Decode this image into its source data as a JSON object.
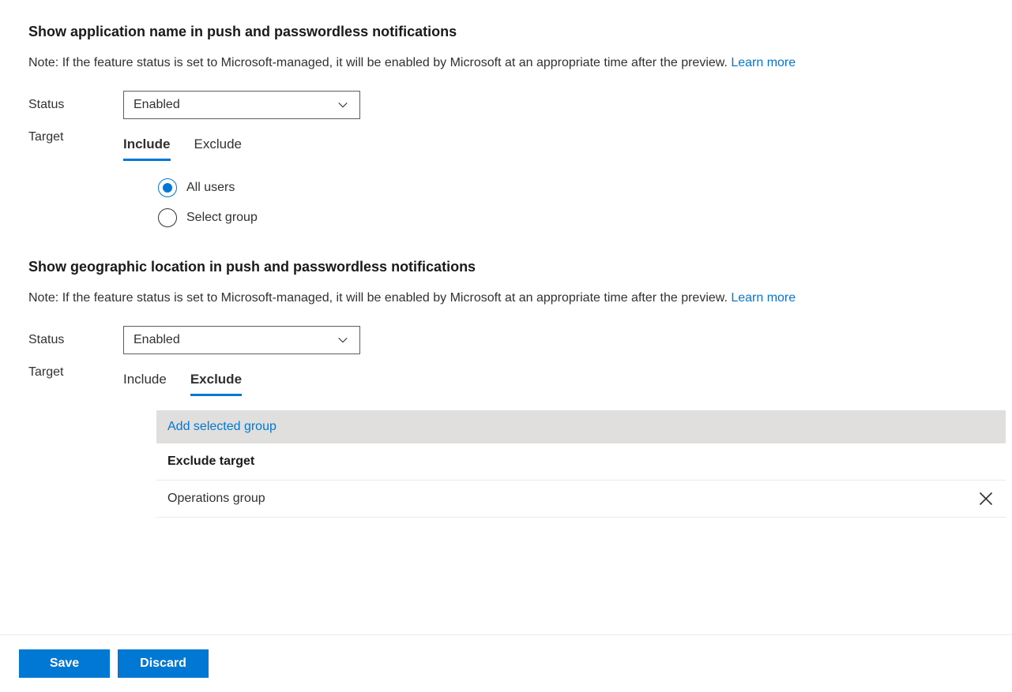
{
  "section1": {
    "title": "Show application name in push and passwordless notifications",
    "note": "Note: If the feature status is set to Microsoft-managed, it will be enabled by Microsoft at an appropriate time after the preview. ",
    "learn_more": "Learn more",
    "status_label": "Status",
    "status_value": "Enabled",
    "target_label": "Target",
    "tab_include": "Include",
    "tab_exclude": "Exclude",
    "radio_all": "All users",
    "radio_group": "Select group"
  },
  "section2": {
    "title": "Show geographic location in push and passwordless notifications",
    "note": "Note: If the feature status is set to Microsoft-managed, it will be enabled by Microsoft at an appropriate time after the preview. ",
    "learn_more": "Learn more",
    "status_label": "Status",
    "status_value": "Enabled",
    "target_label": "Target",
    "tab_include": "Include",
    "tab_exclude": "Exclude",
    "add_group": "Add selected group",
    "table_header": "Exclude target",
    "rows": [
      {
        "name": "Operations group"
      }
    ]
  },
  "footer": {
    "save": "Save",
    "discard": "Discard"
  }
}
